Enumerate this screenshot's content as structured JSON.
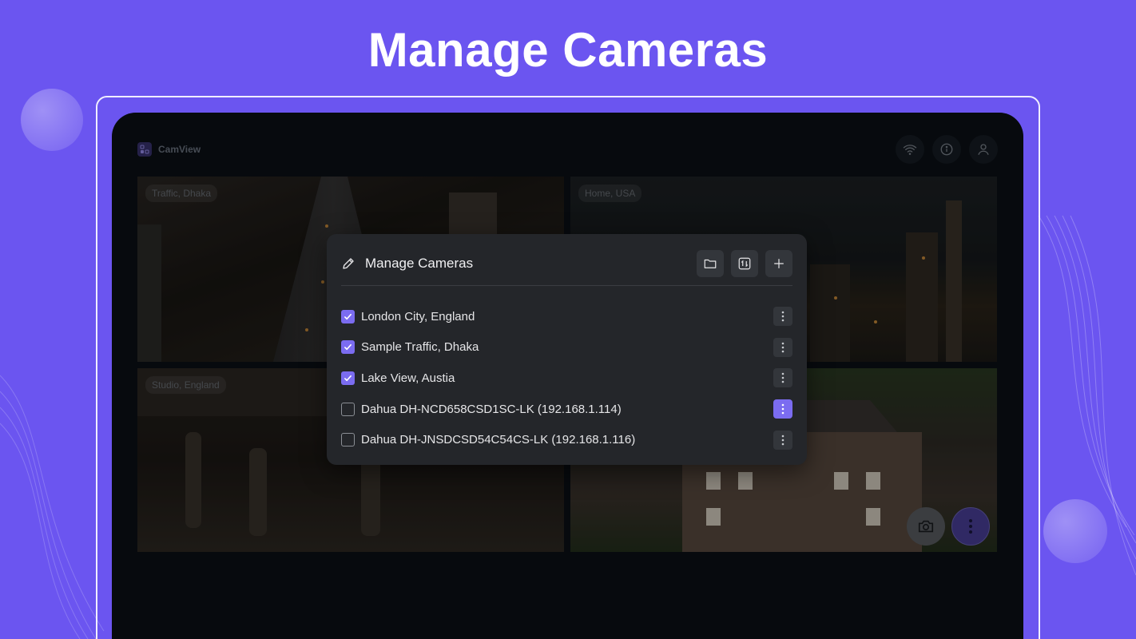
{
  "headline": "Manage Cameras",
  "app": {
    "brand": "CamView",
    "logo_icon": "camview-logo-icon"
  },
  "top_actions": [
    {
      "icon": "wifi-icon"
    },
    {
      "icon": "info-icon"
    },
    {
      "icon": "user-icon"
    }
  ],
  "tiles": [
    {
      "label": "Traffic, Dhaka"
    },
    {
      "label": "Home, USA"
    },
    {
      "label": "Studio, England"
    },
    {
      "label": ""
    }
  ],
  "dialog": {
    "title": "Manage Cameras",
    "title_icon": "pencil-icon",
    "actions": [
      {
        "icon": "folder-icon"
      },
      {
        "icon": "swap-icon"
      },
      {
        "icon": "plus-icon"
      }
    ],
    "cameras": [
      {
        "name": "London City, England",
        "checked": true,
        "menu_active": false
      },
      {
        "name": "Sample Traffic, Dhaka",
        "checked": true,
        "menu_active": false
      },
      {
        "name": "Lake View, Austia",
        "checked": true,
        "menu_active": false
      },
      {
        "name": "Dahua DH-NCD658CSD1SC-LK (192.168.1.114)",
        "checked": false,
        "menu_active": true
      },
      {
        "name": "Dahua DH-JNSDCSD54C54CS-LK (192.168.1.116)",
        "checked": false,
        "menu_active": false
      }
    ]
  },
  "colors": {
    "background": "#6b55f0",
    "accent": "#7b6cf0",
    "dialog": "#24262a"
  }
}
